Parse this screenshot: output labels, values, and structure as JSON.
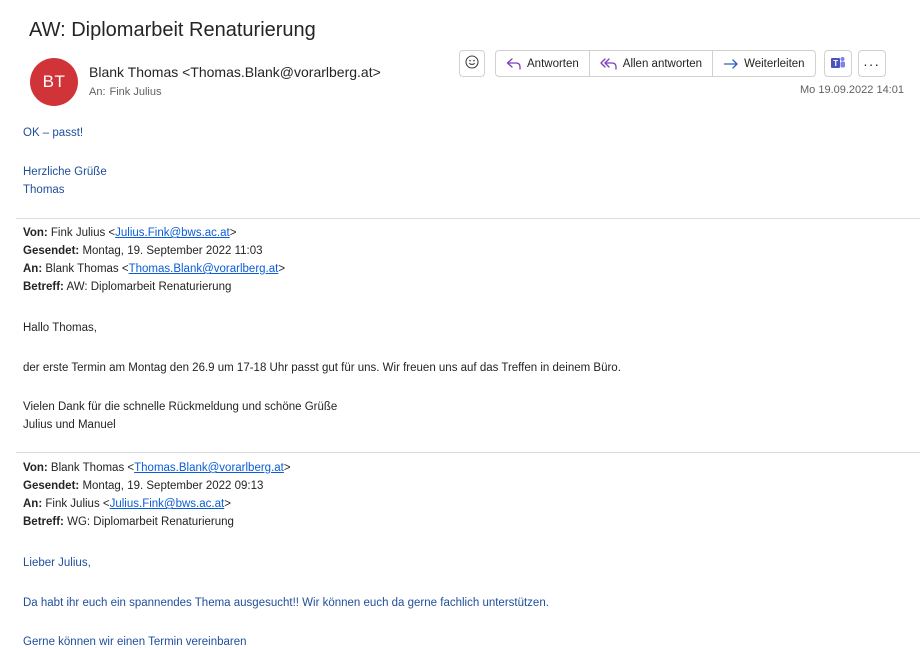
{
  "email": {
    "subject": "AW: Diplomarbeit Renaturierung",
    "avatar_initials": "BT",
    "avatar_color": "#d13438",
    "sender": "Blank Thomas <Thomas.Blank@vorarlberg.at>",
    "to_label": "An:",
    "to_name": "Fink Julius",
    "date": "Mo 19.09.2022 14:01"
  },
  "toolbar": {
    "emoji_icon": "emoji-icon",
    "reply_label": "Antworten",
    "reply_all_label": "Allen antworten",
    "forward_label": "Weiterleiten",
    "teams_icon": "teams-icon",
    "more_label": "···"
  },
  "reply": {
    "line1": "OK – passt!",
    "greeting1": "Herzliche Grüße",
    "greeting2": "Thomas"
  },
  "quote1": {
    "from_label": "Von:",
    "from_name": "Fink Julius <",
    "from_email": "Julius.Fink@bws.ac.at",
    "from_end": ">",
    "sent_label": "Gesendet:",
    "sent_value": "Montag, 19. September 2022 11:03",
    "to_label": "An:",
    "to_name": "Blank Thomas <",
    "to_email": "Thomas.Blank@vorarlberg.at",
    "to_end": ">",
    "subject_label": "Betreff:",
    "subject_value": "AW: Diplomarbeit Renaturierung",
    "salutation": "Hallo Thomas,",
    "paragraph": "der erste Termin am Montag den 26.9 um 17-18 Uhr passt gut für uns. Wir freuen uns auf das Treffen in deinem Büro.",
    "closing1": "Vielen Dank für die schnelle Rückmeldung und schöne Grüße",
    "closing2": "Julius und Manuel"
  },
  "quote2": {
    "from_label": "Von:",
    "from_name": "Blank Thomas <",
    "from_email": "Thomas.Blank@vorarlberg.at",
    "from_end": ">",
    "sent_label": "Gesendet:",
    "sent_value": "Montag, 19. September 2022 09:13",
    "to_label": "An:",
    "to_name": "Fink Julius <",
    "to_email": "Julius.Fink@bws.ac.at",
    "to_end": ">",
    "subject_label": "Betreff:",
    "subject_value": "WG: Diplomarbeit Renaturierung",
    "salutation": "Lieber Julius,",
    "paragraph": "Da habt ihr euch ein spannendes Thema ausgesucht!! Wir können euch da gerne fachlich unterstützen.",
    "paragraph2": "Gerne können wir einen Termin vereinbaren"
  }
}
